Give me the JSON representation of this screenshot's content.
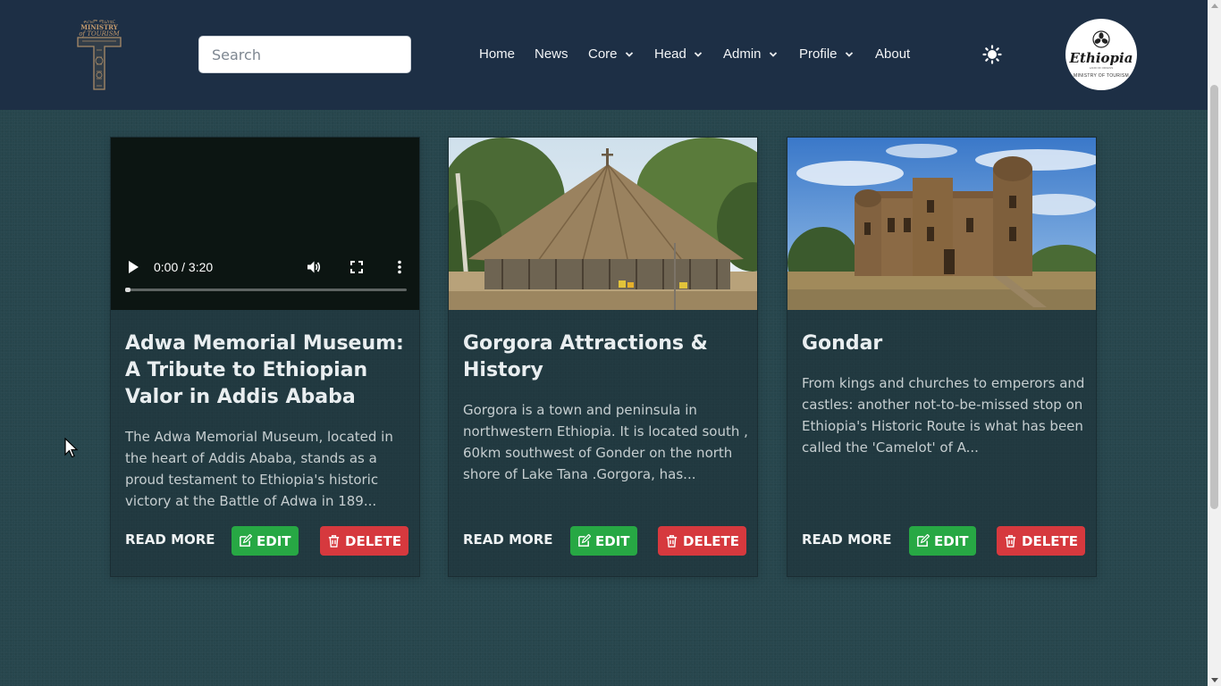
{
  "navbar": {
    "logo_left": {
      "line1": "ቱሪዝም ሚኒስቴር",
      "line2": "MINISTRY",
      "line3": "of TOURISM",
      "icon": "ministry-t-logo"
    },
    "search": {
      "placeholder": "Search",
      "value": ""
    },
    "links": [
      {
        "label": "Home",
        "dropdown": false
      },
      {
        "label": "News",
        "dropdown": false
      },
      {
        "label": "Core",
        "dropdown": true
      },
      {
        "label": "Head",
        "dropdown": true
      },
      {
        "label": "Admin",
        "dropdown": true
      },
      {
        "label": "Profile",
        "dropdown": true
      },
      {
        "label": "About",
        "dropdown": false
      }
    ],
    "theme_icon": "sun-icon",
    "logo_right": {
      "brand": "Ethiopia",
      "tagline": "LAND OF ORIGINS",
      "sub": "MINISTRY OF TOURISM"
    }
  },
  "colors": {
    "navbar": "#1d2f45",
    "background": "#27464d",
    "edit": "#27a844",
    "delete": "#d6393e"
  },
  "cards": [
    {
      "media": "video",
      "video_time": "0:00 / 3:20",
      "title": "Adwa Memorial Museum: A Tribute to Ethiopian Valor in Addis Ababa",
      "description": "The Adwa Memorial Museum, located in the heart of Addis Ababa, stands as a proud testament to Ethiopia's historic victory at the Battle of Adwa in 189...",
      "read_more": "READ MORE",
      "edit": "EDIT",
      "delete": "DELETE"
    },
    {
      "media": "image",
      "image_subject": "thatched round church under trees",
      "title": "Gorgora Attractions & History",
      "description": "Gorgora is a town and peninsula in northwestern Ethiopia. It is located south , 60km southwest of Gonder on the north shore of Lake Tana .Gorgora, has...",
      "read_more": "READ MORE",
      "edit": "EDIT",
      "delete": "DELETE"
    },
    {
      "media": "image",
      "image_subject": "stone castle with round towers under blue sky",
      "title": "Gondar",
      "description": "From kings and churches to emperors and castles: another not-to-be-missed stop on Ethiopia's Historic Route is what has been called the 'Camelot' of A...",
      "read_more": "READ MORE",
      "edit": "EDIT",
      "delete": "DELETE"
    }
  ]
}
